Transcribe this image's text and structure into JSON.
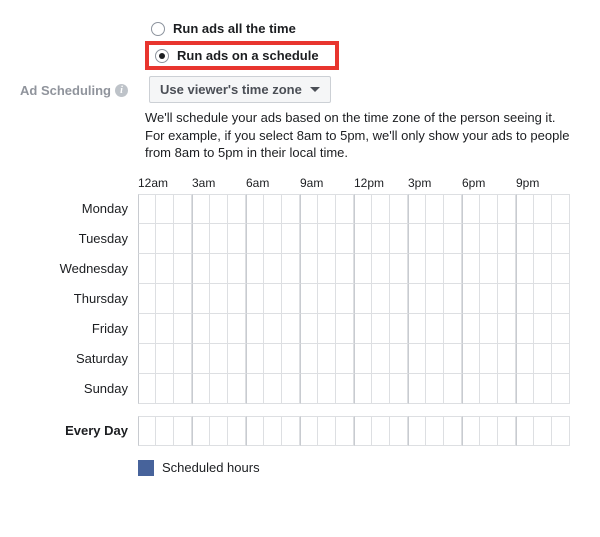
{
  "section_label": "Ad Scheduling",
  "radio": {
    "all_time": "Run ads all the time",
    "schedule": "Run ads on a schedule",
    "selected": "schedule"
  },
  "timezone_dropdown": {
    "selected": "Use viewer's time zone"
  },
  "description": {
    "line1": "We'll schedule your ads based on the time zone of the person seeing it.",
    "line2": "For example, if you select 8am to 5pm, we'll only show your ads to people from 8am to 5pm in their local time."
  },
  "hours": [
    "12am",
    "3am",
    "6am",
    "9am",
    "12pm",
    "3pm",
    "6pm",
    "9pm"
  ],
  "days": [
    "Monday",
    "Tuesday",
    "Wednesday",
    "Thursday",
    "Friday",
    "Saturday",
    "Sunday"
  ],
  "every_day_label": "Every Day",
  "legend_label": "Scheduled hours"
}
